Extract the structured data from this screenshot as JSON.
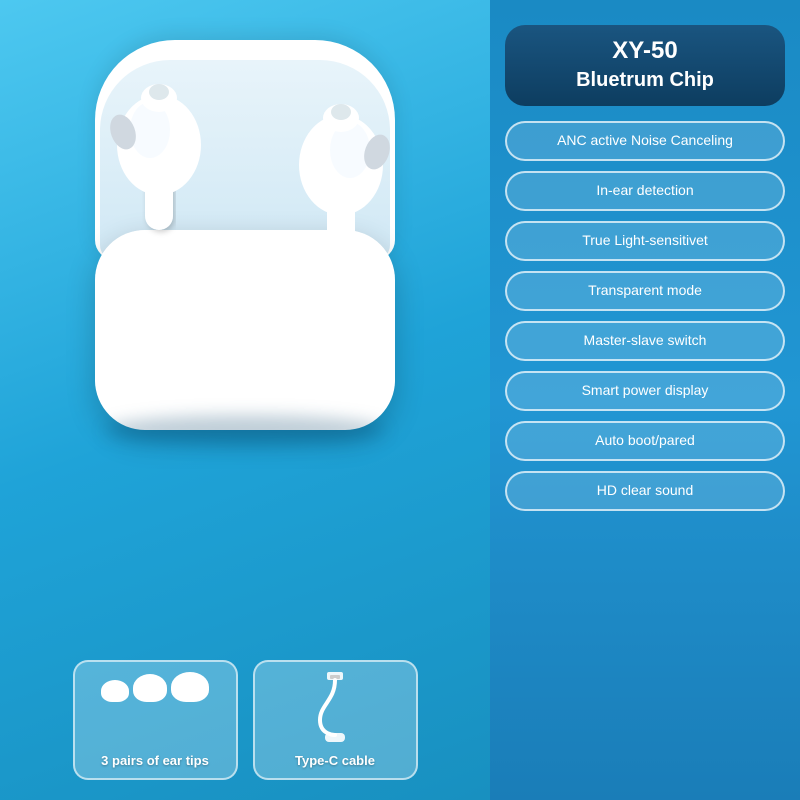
{
  "product": {
    "model": "XY-50",
    "chip": "Bluetrum Chip"
  },
  "features": [
    {
      "id": "anc",
      "label": "ANC active Noise Canceling"
    },
    {
      "id": "in-ear",
      "label": "In-ear detection"
    },
    {
      "id": "light",
      "label": "True Light-sensitivet"
    },
    {
      "id": "transparent",
      "label": "Transparent mode"
    },
    {
      "id": "master-slave",
      "label": "Master-slave switch"
    },
    {
      "id": "smart-power",
      "label": "Smart power display"
    },
    {
      "id": "auto-boot",
      "label": "Auto boot/pared"
    },
    {
      "id": "hd-sound",
      "label": "HD clear sound"
    }
  ],
  "accessories": [
    {
      "id": "ear-tips",
      "label": "3 pairs of ear tips"
    },
    {
      "id": "cable",
      "label": "Type-C cable"
    }
  ]
}
